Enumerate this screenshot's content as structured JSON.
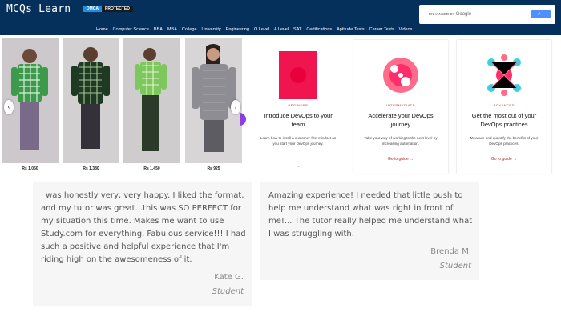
{
  "header": {
    "logo": "MCQs Learn",
    "dmca_badge": "DMCA",
    "dmca_status": "PROTECTED",
    "search_prefix": "ENHANCED BY",
    "search_brand": "Google",
    "search_icon": "search-icon",
    "nav": [
      "Home",
      "Computer Science",
      "BBA",
      "MBA",
      "College",
      "University",
      "Engineering",
      "O Level",
      "A Level",
      "SAT",
      "Certifications",
      "Aptitude Tests",
      "Career Tests",
      "Videos"
    ]
  },
  "carousel": {
    "prices": [
      "Rs 1,050",
      "Rs 1,380",
      "Rs 1,450",
      "Rs 925"
    ],
    "prev_icon": "chevron-left-icon",
    "next_icon": "chevron-right-icon"
  },
  "cards": [
    {
      "tag": "BEGINNER",
      "title": "Introduce DevOps to your team",
      "desc": "Learn how to instill a customer-first mindset as you start your DevOps journey.",
      "link": "→"
    },
    {
      "tag": "INTERMEDIATE",
      "title": "Accelerate your DevOps journey",
      "desc": "Take your way of working to the next level by increasing automation.",
      "link": "Go to guide →"
    },
    {
      "tag": "ADVANCED",
      "title": "Get the most out of your DevOps practices",
      "desc": "Measure and quantify the benefits of your DevOps practices.",
      "link": "Go to guide →"
    }
  ],
  "testimonials": [
    {
      "quote": "I was honestly very, very happy. I liked the format, and my tutor was great...this was SO PERFECT for my situation this time. Makes me want to use Study.com for everything. Fabulous service!!! I had such a positive and helpful experience that I'm riding high on the awesomeness of it.",
      "name": "Kate G.",
      "role": "Student"
    },
    {
      "quote": "Amazing experience! I needed that little push to help me understand what was right in front of me!... The tutor really helped me understand what I was struggling with.",
      "name": "Brenda M.",
      "role": "Student"
    }
  ],
  "colors": {
    "header_bg": "#06305c",
    "accent_red": "#b03030",
    "dmca_blue": "#1f8fe0"
  }
}
